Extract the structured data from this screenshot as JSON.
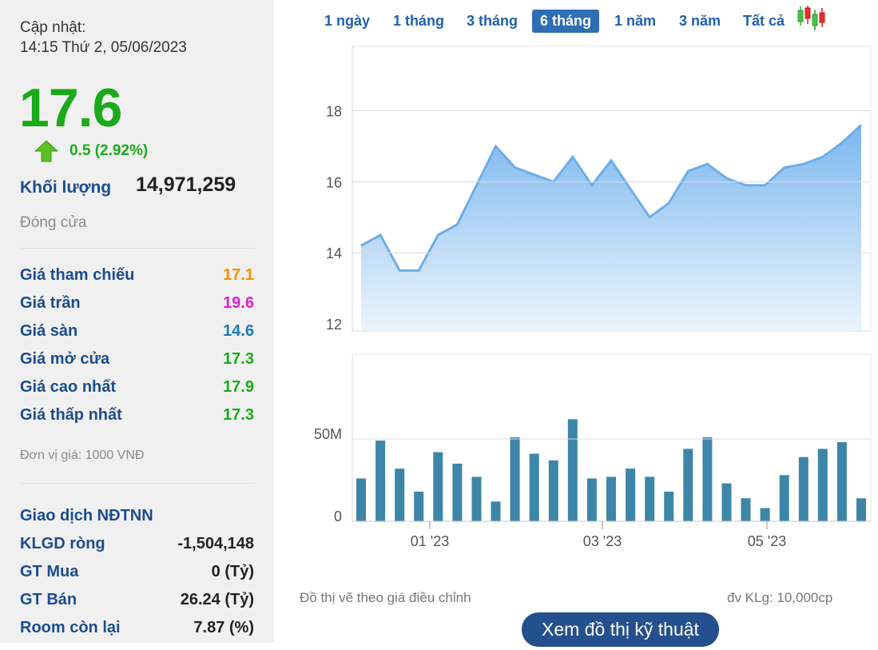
{
  "left_panel": {
    "update_label": "Cập nhật:",
    "update_time": "14:15 Thứ 2, 05/06/2023",
    "price": "17.6",
    "change": "0.5 (2.92%)",
    "volume_label": "Khối lượng",
    "volume_value": "14,971,259",
    "status": "Đóng cửa",
    "price_rows": [
      {
        "label": "Giá tham chiếu",
        "value": "17.1",
        "color": "#f39200"
      },
      {
        "label": "Giá trần",
        "value": "19.6",
        "color": "#e01fd0"
      },
      {
        "label": "Giá sàn",
        "value": "14.6",
        "color": "#1a7ab8"
      },
      {
        "label": "Giá mở cửa",
        "value": "17.3",
        "color": "#1aaa1a"
      },
      {
        "label": "Giá cao nhất",
        "value": "17.9",
        "color": "#1aaa1a"
      },
      {
        "label": "Giá thấp nhất",
        "value": "17.3",
        "color": "#1aaa1a"
      }
    ],
    "unit_note": "Đơn vị giá: 1000 VNĐ",
    "foreign_title": "Giao dịch NĐTNN",
    "foreign_rows": [
      {
        "label": "KLGD ròng",
        "value": "-1,504,148"
      },
      {
        "label": "GT Mua",
        "value": "0 (Tỷ)"
      },
      {
        "label": "GT Bán",
        "value": "26.24 (Tỷ)"
      },
      {
        "label": "Room còn lại",
        "value": "7.87 (%)"
      }
    ],
    "colors": {
      "up": "#1aaa1a",
      "label": "#1a4d8f"
    }
  },
  "range_tabs": [
    {
      "label": "1 ngày",
      "active": false
    },
    {
      "label": "1 tháng",
      "active": false
    },
    {
      "label": "3 tháng",
      "active": false
    },
    {
      "label": "6 tháng",
      "active": true
    },
    {
      "label": "1 năm",
      "active": false
    },
    {
      "label": "3 năm",
      "active": false
    },
    {
      "label": "Tất cả",
      "active": false
    }
  ],
  "candlestick_icon": "candlestick-chart-icon",
  "chart_data": [
    {
      "type": "area",
      "series": [
        {
          "values": [
            14.2,
            14.5,
            13.5,
            13.5,
            14.5,
            14.8,
            15.9,
            17.0,
            16.4,
            16.2,
            16.0,
            16.7,
            15.9,
            16.6,
            15.8,
            15.0,
            15.4,
            16.3,
            16.5,
            16.1,
            15.9,
            15.9,
            16.4,
            16.5,
            16.7,
            17.1,
            17.6
          ]
        }
      ],
      "yticks": [
        "12",
        "14",
        "16",
        "18"
      ],
      "ylim": [
        11.8,
        20
      ]
    },
    {
      "type": "bar",
      "series": [
        {
          "values": [
            26,
            49,
            32,
            18,
            42,
            35,
            27,
            12,
            51,
            41,
            37,
            62,
            26,
            27,
            32,
            27,
            18,
            44,
            51,
            23,
            14,
            8,
            28,
            39,
            44,
            48,
            14
          ]
        }
      ],
      "yticks": [
        "0",
        "50M"
      ],
      "xticks": [
        "01 '23",
        "03 '23",
        "05 '23"
      ],
      "ylim": [
        0,
        100
      ]
    }
  ],
  "notes": {
    "adjusted": "Đồ thị vẽ theo giá điều chỉnh",
    "volume_unit": "đv KLg: 10,000cp"
  },
  "tech_button": "Xem đồ thị kỹ thuật"
}
